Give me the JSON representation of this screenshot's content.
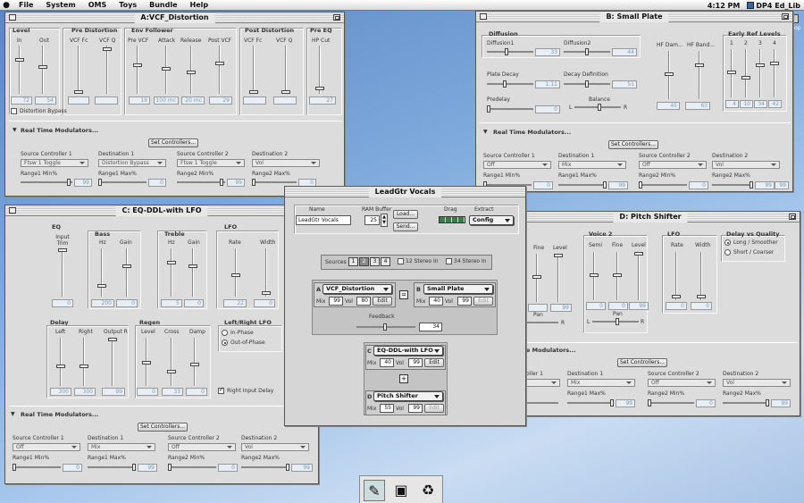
{
  "menubar": {
    "apple": "",
    "items": [
      "File",
      "System",
      "OMS",
      "Toys",
      "Bundle",
      "Help"
    ],
    "time": "4:12 PM",
    "app": "DP4 Ed_Lib"
  },
  "desktop": {
    "hd_label": "Desktop"
  },
  "winA": {
    "title": "A:VCF_Distortion",
    "groups": {
      "level": "Level",
      "predist": "Pre Distortion",
      "envf": "Env Follower",
      "postdist": "Post Distortion",
      "preeq": "Pre EQ"
    },
    "labels": {
      "in": "In",
      "out": "Out",
      "vcffc": "VCF Fc",
      "vcfq": "VCF Q",
      "prevcf": "Pre VCF",
      "attack": "Attack",
      "release": "Release",
      "postvcf": "Post VCF",
      "vcffc2": "VCF Fc",
      "vcfq2": "VCF Q",
      "hpcut": "HP Cut"
    },
    "values": [
      "72",
      "54",
      "",
      "",
      "19",
      "100 mc",
      "20 mc",
      "29",
      "",
      "",
      "27"
    ],
    "distortion_bypass": "Distortion Bypass",
    "rtm": "Real Time Modulators...",
    "set_controllers": "Set Controllers...",
    "sc1": "Source Controller 1",
    "d1": "Destination 1",
    "sc2": "Source Controller 2",
    "d2": "Destination 2",
    "sc1_val": "Ftsw 1 Toggle",
    "d1_val": "Distortion Bypass",
    "sc2_val": "Ftsw 1 Toggle",
    "d2_val": "Vol",
    "r1min": "Range1 Min%",
    "r1max": "Range1 Max%",
    "r2min": "Range2 Min%",
    "r2max": "Range2 Max%",
    "r1min_val": "99",
    "r1max_val": "0",
    "r2min_val": "99",
    "r2max_val": "0"
  },
  "winB": {
    "title": "B: Small Plate",
    "diffusion": "Diffusion",
    "diff1": "Diffusion1",
    "diff2": "Diffusion2",
    "diff1_val": "33",
    "diff2_val": "44",
    "plate_decay": "Plate Decay",
    "plate_decay_val": "1.11",
    "decay_def": "Decay Definition",
    "decay_def_val": "51",
    "predelay": "Predelay",
    "predelay_val": "0",
    "balance": "Balance",
    "bal_l": "L",
    "bal_r": "R",
    "hfdam": "HF Dam...",
    "hfband": "HF Band...",
    "hfdam_val": "45",
    "hfband_val": "63",
    "early": "Early Ref Levels",
    "early_nums": [
      "1",
      "2",
      "3",
      "4"
    ],
    "early_vals": [
      "4",
      "10",
      "34",
      "42"
    ],
    "rtm": "Real Time Modulators...",
    "set_controllers": "Set Controllers...",
    "sc1": "Source Controller 1",
    "d1": "Destination 1",
    "sc2": "Source Controller 2",
    "d2": "Destination 2",
    "sc1_val": "Off",
    "d1_val": "Mix",
    "sc2_val": "Off",
    "d2_val": "Vol",
    "r1min": "Range1 Min%",
    "r1max": "Range1 Max%",
    "r2min": "Range2 Min%",
    "r2max": "Range2 Max%",
    "r1min_val": "0",
    "r1max_val": "99",
    "r2min_val": "0",
    "r2max_val": "99",
    "extra": "99"
  },
  "winC": {
    "title": "C: EQ-DDL-with LFO",
    "eq": "EQ",
    "input_trim": "Input Trim",
    "bass": "Bass",
    "hz": "Hz",
    "gain": "Gain",
    "treble": "Treble",
    "hz2": "Hz",
    "gain2": "Gain",
    "lfo": "LFO",
    "rate": "Rate",
    "width": "Width",
    "trim_val": "0",
    "bass_hz_val": "200",
    "bass_gain_val": "0",
    "tre_hz_val": "5",
    "tre_gain_val": "0",
    "rate_val": "22",
    "width_val": "0",
    "delay": "Delay",
    "left": "Left",
    "right": "Right",
    "output": "Output R",
    "left_val": "300",
    "right_val": "300",
    "output_val": "99",
    "regen": "Regen",
    "level": "Level",
    "cross": "Cross",
    "damp": "Damp",
    "level_val": "0",
    "cross_val": "33",
    "damp_val": "0",
    "lr_lfo": "Left/Right LFO",
    "in_phase": "In-Phase",
    "out_phase": "Out-of-Phase",
    "right_input_delay": "Right Input Delay",
    "rtm": "Real Time Modulators...",
    "set_controllers": "Set Controllers...",
    "sc1": "Source Controller 1",
    "d1": "Destination 1",
    "sc2": "Source Controller 2",
    "d2": "Destination 2",
    "sc1_val": "Off",
    "d1_val": "Mix",
    "sc2_val": "Off",
    "d2_val": "Vol",
    "r1min": "Range1 Min%",
    "r1max": "Range1 Max%",
    "r2min": "Range2 Min%",
    "r2max": "Range2 Max%",
    "r1min_val": "0",
    "r1max_val": "99",
    "r2min_val": "0",
    "r2max_val": "99"
  },
  "winD": {
    "title": "D: Pitch Shifter",
    "fine": "Fine",
    "level": "Level",
    "fine_val": "",
    "level_val": "99",
    "pan": "Pan",
    "pan_r": "R",
    "voice2": "Voice 2",
    "semi": "Semi",
    "fine2": "Fine",
    "level2": "Level",
    "semi_val": "0",
    "fine2_val": "0",
    "level2_val": "99",
    "pan2": "Pan",
    "pan2_l": "L",
    "pan2_r": "R",
    "lfo": "LFO",
    "rate": "Rate",
    "width": "Width",
    "rate_val": "0",
    "width_val": "0",
    "dvq": "Delay vs Quality",
    "long": "Long / Smoother",
    "short": "Short / Coarser",
    "rtm": "e Modulators...",
    "set_controllers": "Set Controllers...",
    "sc1": "oller 1",
    "d1": "Destination 1",
    "sc2": "Source Controller 2",
    "d2": "Destination 2",
    "d1_val": "Mix",
    "sc2_val": "Off",
    "d2_val": "Vol",
    "r1max": "Range1 Max%",
    "r2min": "Range2 Min%",
    "r2max": "Range2 Max%",
    "r1max_val": "99",
    "r2min_val": "0",
    "r2max_val": "99"
  },
  "main": {
    "title": "LeadGtr Vocals",
    "name_label": "Name",
    "name_val": "LeadGtr Vocals",
    "ram_label": "RAM Buffer",
    "ram_val": "25",
    "load": "Load...",
    "send": "Send...",
    "drag_label": "Drag",
    "extract_label": "Extract",
    "extract_val": "Config",
    "sources_label": "Sources",
    "sources": [
      "1",
      "2",
      "3",
      "4"
    ],
    "stereo12": "12 Stereo In",
    "stereo34": "34 Stereo In",
    "a_letter": "A",
    "a_name": "VCF_Distortion",
    "a_mix": "Mix",
    "a_mix_val": "99",
    "a_vol": "Vol",
    "a_vol_val": "80",
    "a_edit": "Edit",
    "b_letter": "B",
    "b_name": "Small Plate",
    "b_mix": "Mix",
    "b_mix_val": "40",
    "b_vol": "Vol",
    "b_vol_val": "99",
    "b_edit": "Edit",
    "feedback": "Feedback",
    "feedback_val": "34",
    "c_letter": "C",
    "c_name": "EQ-DDL-with LFO",
    "c_mix": "Mix",
    "c_mix_val": "40",
    "c_vol": "Vol",
    "c_vol_val": "99",
    "c_edit": "Edit",
    "d_letter": "D",
    "d_name": "Pitch Shifter",
    "d_mix": "Mix",
    "d_mix_val": "55",
    "d_vol": "Vol",
    "d_vol_val": "99",
    "d_edit": "Edit"
  }
}
